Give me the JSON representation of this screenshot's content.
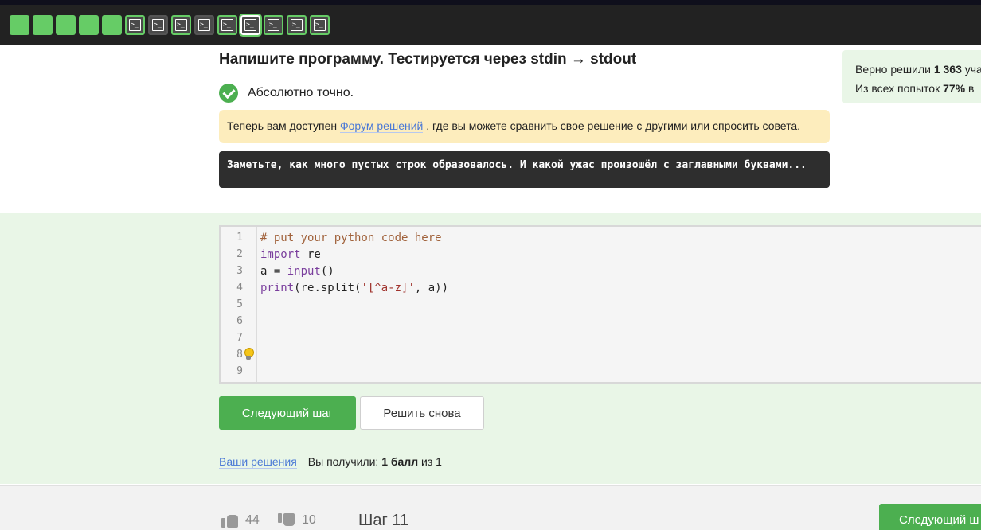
{
  "colors": {
    "accent_green": "#4caf50",
    "step_done": "#66cc66",
    "topbar_bg": "#222222",
    "solution_bg": "#e9f6e7",
    "forum_bg": "#fdedbd",
    "link": "#4b79d6"
  },
  "steps": [
    {
      "type": "theory",
      "state": "done"
    },
    {
      "type": "theory",
      "state": "done"
    },
    {
      "type": "theory",
      "state": "done"
    },
    {
      "type": "theory",
      "state": "done"
    },
    {
      "type": "theory",
      "state": "done"
    },
    {
      "type": "code",
      "state": "done",
      "icon": "terminal-icon"
    },
    {
      "type": "code",
      "state": "plain",
      "icon": "terminal-icon"
    },
    {
      "type": "code",
      "state": "done",
      "icon": "terminal-icon"
    },
    {
      "type": "code",
      "state": "plain",
      "icon": "terminal-icon"
    },
    {
      "type": "code",
      "state": "done",
      "icon": "terminal-icon"
    },
    {
      "type": "code",
      "state": "current",
      "icon": "terminal-icon"
    },
    {
      "type": "code",
      "state": "done",
      "icon": "terminal-icon"
    },
    {
      "type": "code",
      "state": "done",
      "icon": "terminal-icon"
    },
    {
      "type": "code",
      "state": "done",
      "icon": "terminal-icon"
    }
  ],
  "task": {
    "title": "Напишите программу. Тестируется через stdin → stdout",
    "verdict": "Абсолютно точно.",
    "forum_before": "Теперь вам доступен ",
    "forum_link": "Форум решений",
    "forum_after": " , где вы можете сравнить свое решение с другими или спросить совета.",
    "hint": "Заметьте, как много пустых строк образовалось. И какой ужас произошёл с заглавными буквами..."
  },
  "stats": {
    "line1_prefix": "Верно решили ",
    "line1_value": "1 363",
    "line1_suffix": " уча",
    "line2_prefix": "Из всех попыток ",
    "line2_value": "77%",
    "line2_suffix": " в"
  },
  "editor": {
    "line_numbers": [
      "1",
      "2",
      "3",
      "4",
      "5",
      "6",
      "7",
      "8",
      "9"
    ],
    "lines": [
      "# put your python code here",
      "import re",
      "a = input()",
      "print(re.split('[^a-z]', a))"
    ]
  },
  "actions": {
    "next_step": "Следующий шаг",
    "solve_again": "Решить снова"
  },
  "result": {
    "your_solutions": "Ваши решения",
    "score_prefix": "Вы получили: ",
    "score_value": "1 балл",
    "score_suffix": " из 1"
  },
  "footer": {
    "likes": "44",
    "dislikes": "10",
    "step_label": "Шаг 11",
    "next_step": "Следующий ш"
  }
}
